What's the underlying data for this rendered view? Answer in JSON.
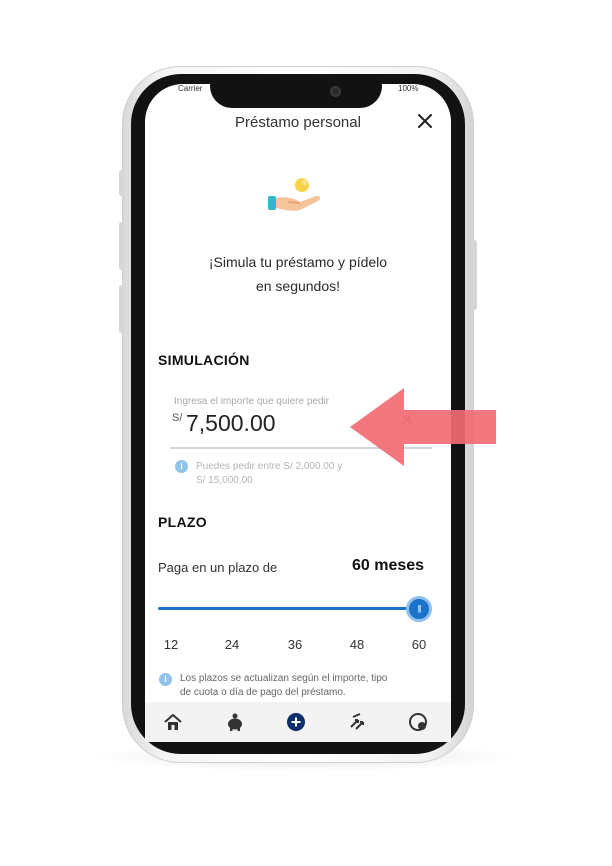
{
  "status_bar": {
    "carrier": "Carrier",
    "battery": "100%"
  },
  "header": {
    "title": "Préstamo personal",
    "close_icon": "close-icon"
  },
  "hero": {
    "icon": "hand-coin-icon",
    "line1": "¡Simula tu préstamo y pídelo",
    "line2": "en segundos!"
  },
  "simulation": {
    "section_title": "SIMULACIÓN",
    "amount_label": "Ingresa el importe que quiere pedir",
    "currency": "S/",
    "amount_value": "7,500.00",
    "clear_icon": "clear-icon",
    "hint_icon": "info-icon",
    "hint_line1": "Puedes pedir entre S/ 2,000.00 y",
    "hint_line2": "S/ 15,000.00"
  },
  "term": {
    "section_title": "PLAZO",
    "label": "Paga en un plazo de",
    "value": "60 meses",
    "selected_months": 60,
    "ticks": [
      "12",
      "24",
      "36",
      "48",
      "60"
    ],
    "note_icon": "info-icon",
    "note_line1": "Los plazos se actualizan según el importe, tipo",
    "note_line2": "de cuota o día de pago del préstamo."
  },
  "bottom_nav": {
    "items": [
      "home-icon",
      "piggy-bank-icon",
      "add-icon",
      "transfer-icon",
      "help-icon"
    ]
  },
  "colors": {
    "accent": "#1a73c8",
    "arrow": "#f26b73"
  }
}
